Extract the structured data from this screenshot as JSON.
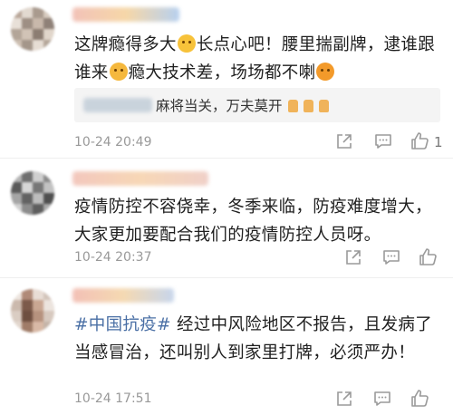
{
  "comments": [
    {
      "text_parts": [
        "这牌瘾得多大",
        "长点心吧！腰里揣副牌，逮谁跟谁来",
        "瘾大技术差，场场都不喇"
      ],
      "reply": {
        "text": "麻将当关，万夫莫开"
      },
      "time": "10-24 20:49",
      "likes": "1"
    },
    {
      "text": "疫情防控不容侥幸，冬季来临，防疫难度增大，大家更加要配合我们的疫情防控人员呀。",
      "time": "10-24 20:37"
    },
    {
      "topic": "#中国抗疫#",
      "text": " 经过中风险地区不报告，且发病了当感冒治，还叫别人到家里打牌，必须严办！",
      "time": "10-24 17:51"
    }
  ],
  "icons": [
    "share-icon",
    "comment-icon",
    "like-icon",
    "emoji-smile-icon",
    "emoji-cry-icon",
    "emoji-angry-icon",
    "thumbs-up-emoji-icon"
  ]
}
